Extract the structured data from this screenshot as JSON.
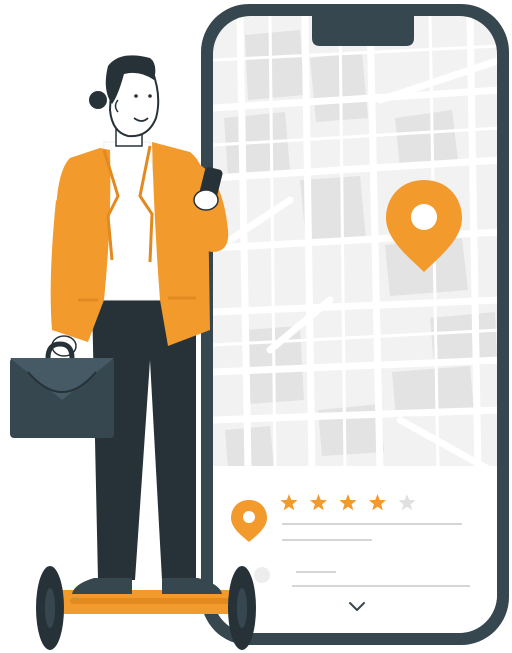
{
  "illustration": {
    "kind": "person on hoverboard checking a map app on a phone",
    "colors": {
      "accent": "#F39A2C",
      "dark": "#37474F",
      "map_bg": "#F2F2F2",
      "map_block": "#E0E0E0",
      "road": "#FFFFFF",
      "star_empty": "#E0E0E0",
      "line": "#D6D6D6"
    }
  },
  "phone": {
    "map": {
      "pin_icon": "location-pin-icon"
    },
    "info_panel": {
      "pin_icon": "location-pin-icon",
      "rating": {
        "filled": 4,
        "max": 5
      },
      "chevron_icon": "chevron-down-icon"
    }
  }
}
